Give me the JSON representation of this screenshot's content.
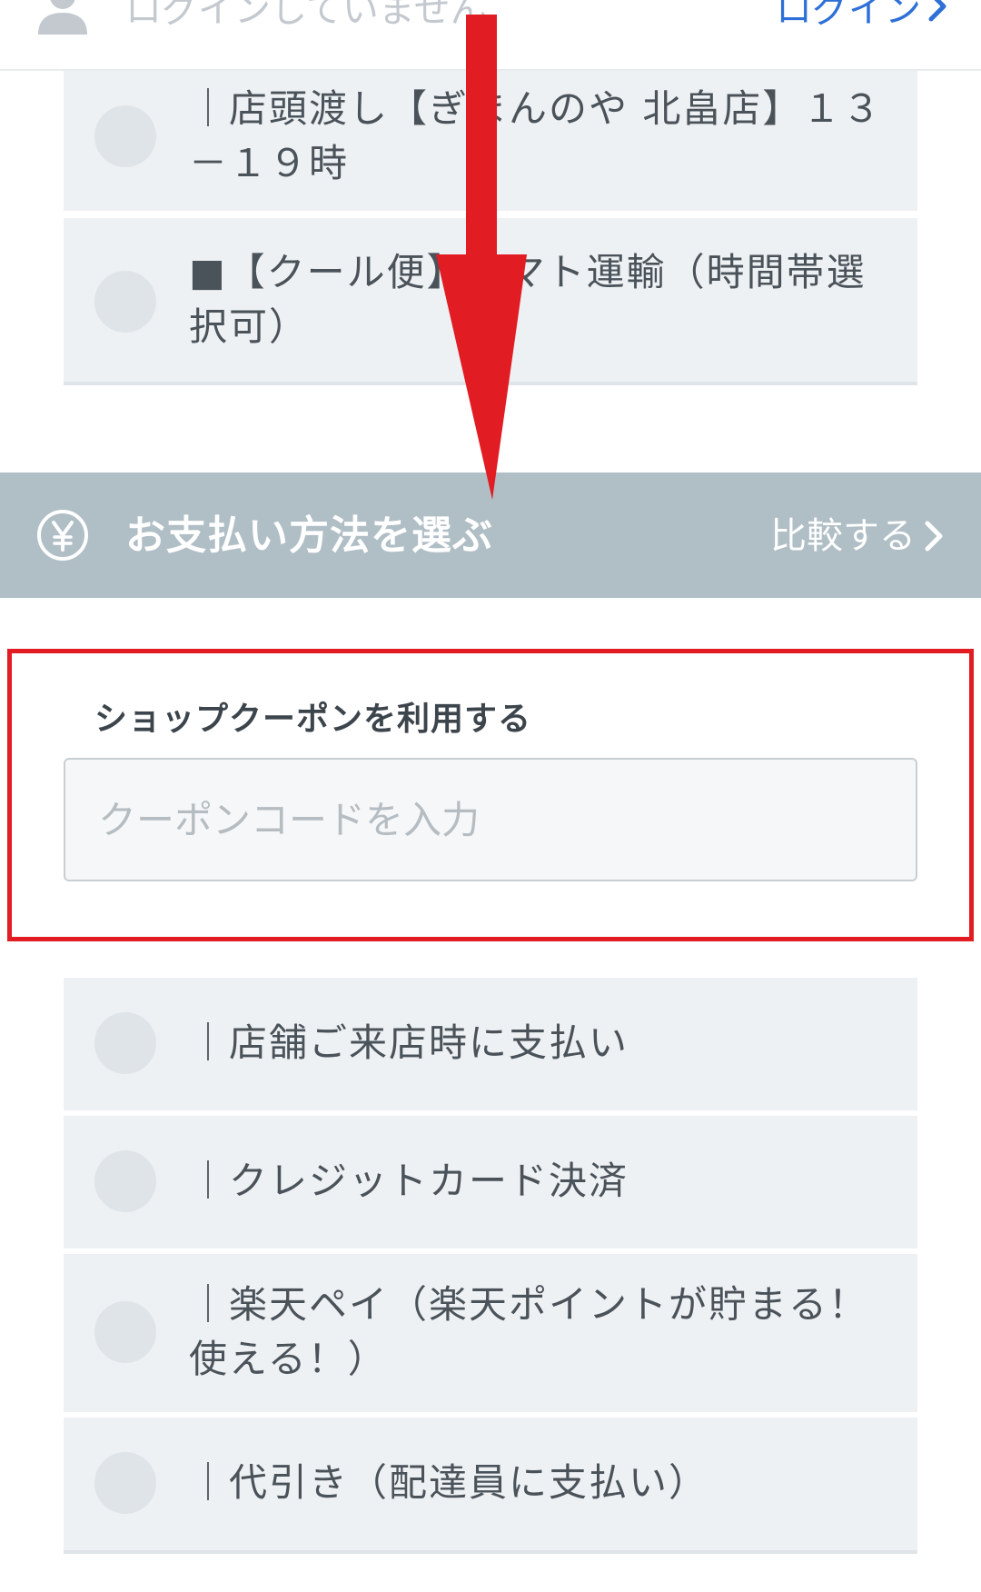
{
  "topbar": {
    "login_status": "ログインしていません",
    "login_link": "ログイン"
  },
  "shipping_options": [
    {
      "label": "｜店頭渡し【ぎまんのや 北畠店】１３－１９時"
    },
    {
      "label": "■【クール便】ヤマト運輸（時間帯選択可）"
    }
  ],
  "payment": {
    "title": "お支払い方法を選ぶ",
    "compare": "比較する"
  },
  "coupon": {
    "label": "ショップクーポンを利用する",
    "placeholder": "クーポンコードを入力",
    "value": ""
  },
  "payment_options": [
    {
      "label": "｜店舗ご来店時に支払い"
    },
    {
      "label": "｜クレジットカード決済"
    },
    {
      "label": "｜楽天ペイ（楽天ポイントが貯まる！使える！）"
    },
    {
      "label": "｜代引き（配達員に支払い）"
    }
  ],
  "colors": {
    "accent_link": "#2f70d8",
    "section_header": "#b0bec5",
    "option_bg": "#eef1f3",
    "annotation_red": "#e11c23"
  },
  "icons": {
    "user": "user-icon",
    "yen": "yen-circle-icon",
    "chevron": "chevron-right-icon",
    "radio": "radio-unselected"
  }
}
